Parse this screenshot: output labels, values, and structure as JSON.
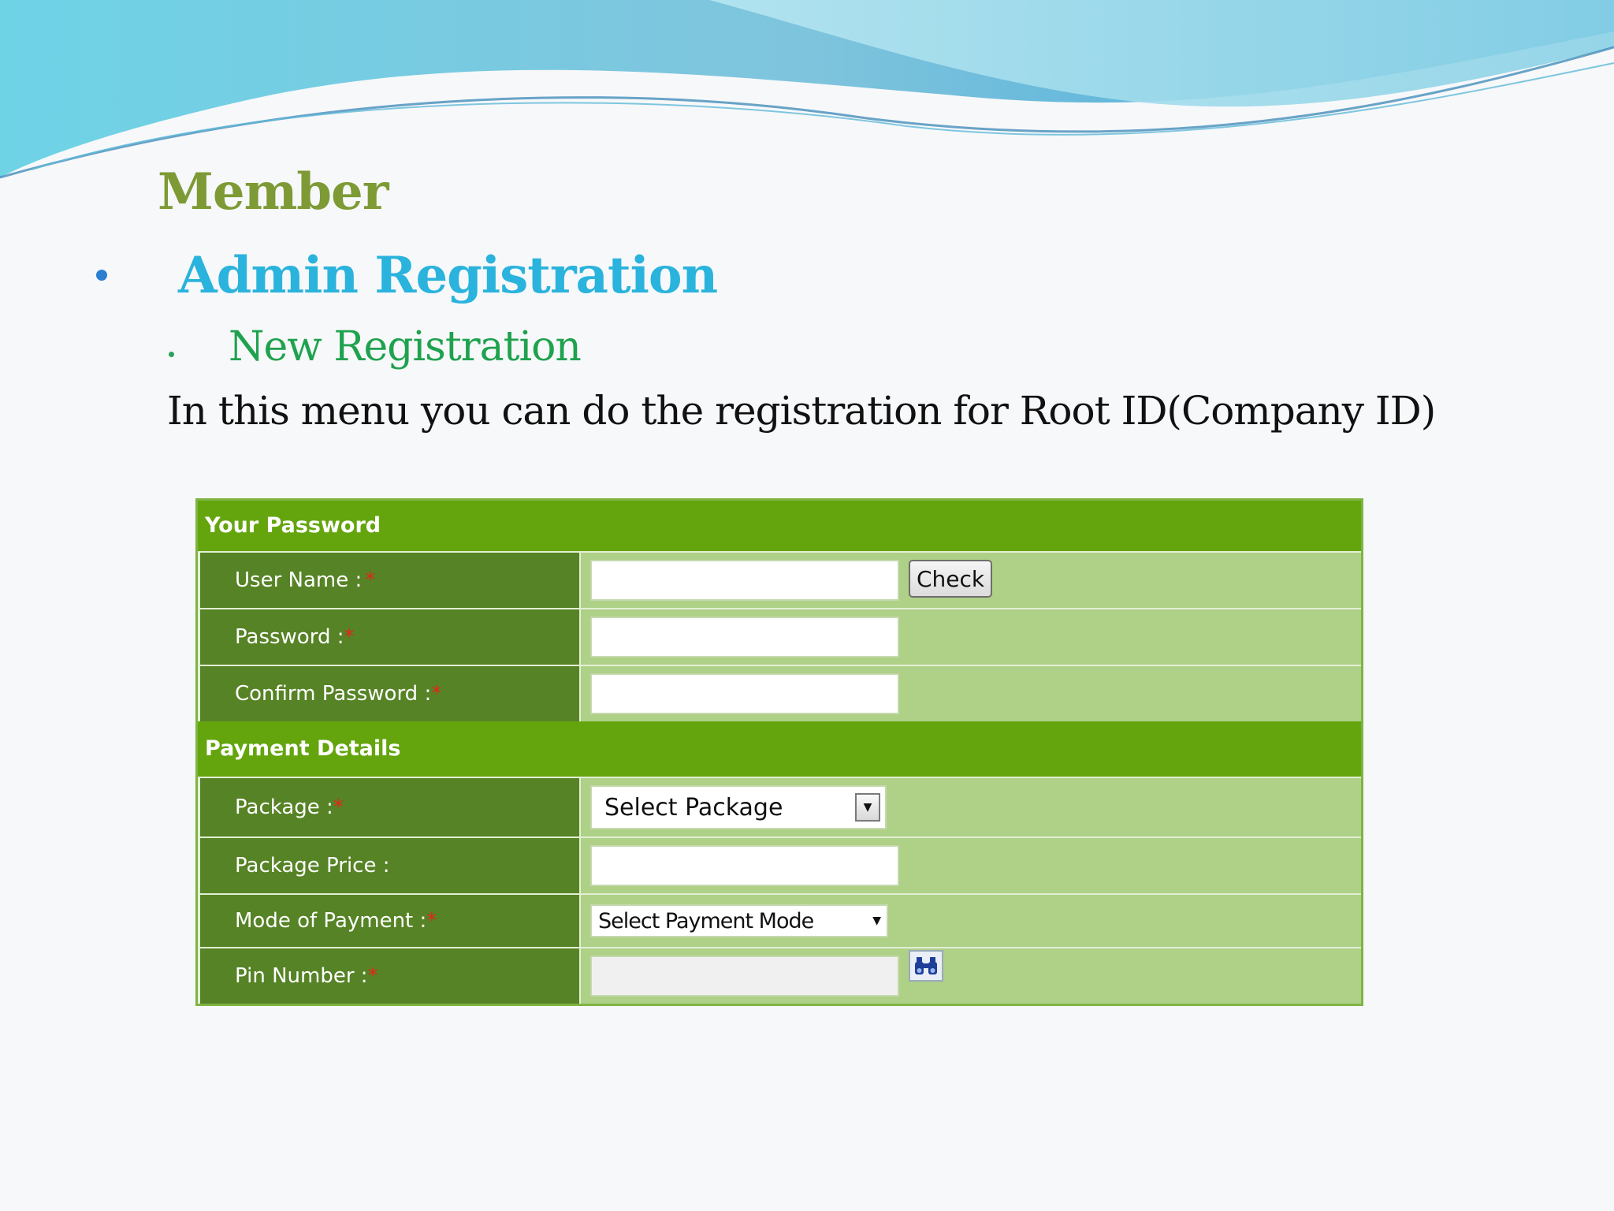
{
  "slide": {
    "title": "Member",
    "heading": "Admin Registration",
    "subheading": "New Registration",
    "description": "In  this menu you can do the registration for Root  ID(Company ID)"
  },
  "form": {
    "section_password": "Your Password",
    "user_name_label": "User Name : ",
    "password_label": "Password :",
    "confirm_password_label": "Confirm Password :",
    "check_button": "Check",
    "section_payment": "Payment Details",
    "package_label": "Package :",
    "package_value": "Select Package",
    "package_price_label": "Package Price :",
    "mode_of_payment_label": "Mode of Payment :",
    "mode_of_payment_value": "Select Payment Mode",
    "pin_number_label": "Pin Number :",
    "required_mark": "*",
    "search_icon": "binoculars-icon"
  },
  "colors": {
    "title": "#7d9a35",
    "heading": "#2ab3dc",
    "subheading": "#1fa24e",
    "section_header": "#64a50e",
    "label_bg": "#568325",
    "field_bg": "#aed087"
  }
}
